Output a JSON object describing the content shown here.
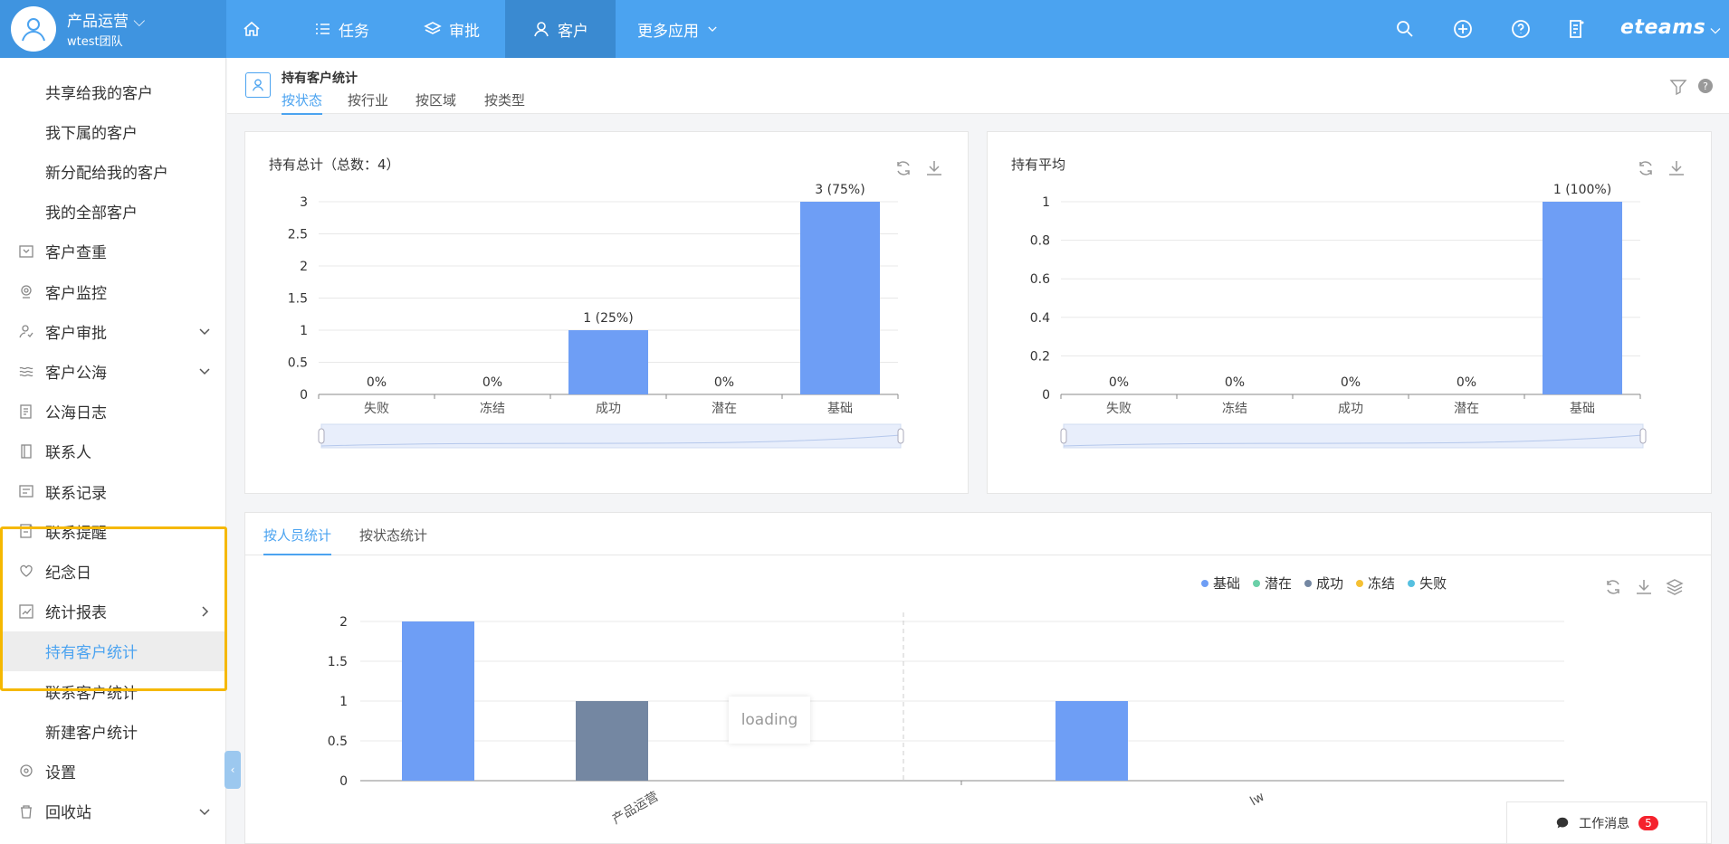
{
  "colors": {
    "topbar": "#4ba3f0",
    "bar_blue": "#6e9ef5",
    "bar_gray": "#7487a2",
    "highlight": "#f5b800",
    "accent": "#4ba3f0"
  },
  "header": {
    "team_name": "产品运营",
    "team_sub": "wtest团队",
    "nav": [
      {
        "label": "任务",
        "icon": "list-icon"
      },
      {
        "label": "审批",
        "icon": "layers-icon"
      },
      {
        "label": "客户",
        "icon": "user-icon"
      },
      {
        "label": "更多应用",
        "icon": "chevron-down-icon"
      }
    ],
    "brand": "eteams"
  },
  "sidebar": {
    "items": [
      {
        "label": "共享给我的客户",
        "icon": "",
        "sub": true
      },
      {
        "label": "我下属的客户",
        "icon": "",
        "sub": true
      },
      {
        "label": "新分配给我的客户",
        "icon": "",
        "sub": true
      },
      {
        "label": "我的全部客户",
        "icon": "",
        "sub": true
      },
      {
        "label": "客户查重",
        "icon": "dedupe-icon"
      },
      {
        "label": "客户监控",
        "icon": "camera-icon"
      },
      {
        "label": "客户审批",
        "icon": "approval-icon",
        "chevron": "down"
      },
      {
        "label": "客户公海",
        "icon": "waves-icon",
        "chevron": "down"
      },
      {
        "label": "公海日志",
        "icon": "log-icon"
      },
      {
        "label": "联系人",
        "icon": "contact-book-icon"
      },
      {
        "label": "联系记录",
        "icon": "record-icon"
      },
      {
        "label": "联系提醒",
        "icon": "reminder-icon"
      },
      {
        "label": "纪念日",
        "icon": "heart-icon"
      },
      {
        "label": "统计报表",
        "icon": "chart-icon",
        "chevron": "right"
      },
      {
        "label": "持有客户统计",
        "icon": "",
        "sub": true,
        "selected": true
      },
      {
        "label": "联系客户统计",
        "icon": "",
        "sub": true
      },
      {
        "label": "新建客户统计",
        "icon": "",
        "sub": true
      },
      {
        "label": "设置",
        "icon": "settings-icon"
      },
      {
        "label": "回收站",
        "icon": "trash-icon",
        "chevron": "down"
      }
    ]
  },
  "content": {
    "title": "持有客户统计",
    "tabs": [
      "按状态",
      "按行业",
      "按区域",
      "按类型"
    ],
    "active_tab": 0
  },
  "card1": {
    "title": "持有总计（总数：4）"
  },
  "card2": {
    "title": "持有平均"
  },
  "bottom": {
    "tabs": [
      "按人员统计",
      "按状态统计"
    ],
    "legend": [
      {
        "name": "基础",
        "color": "#6e9ef5"
      },
      {
        "name": "潜在",
        "color": "#6bd0a8"
      },
      {
        "name": "成功",
        "color": "#7487a2"
      },
      {
        "name": "冻结",
        "color": "#f5c033"
      },
      {
        "name": "失败",
        "color": "#56c0e0"
      }
    ],
    "loading": "loading"
  },
  "message": {
    "label": "工作消息",
    "count": "5"
  },
  "chart_data": [
    {
      "type": "bar",
      "title": "持有总计（总数：4）",
      "categories": [
        "失败",
        "冻结",
        "成功",
        "潜在",
        "基础"
      ],
      "values": [
        0,
        0,
        1,
        0,
        3
      ],
      "data_labels": [
        "0%",
        "0%",
        "1 (25%)",
        "0%",
        "3 (75%)"
      ],
      "yticks": [
        "0",
        "0.5",
        "1",
        "1.5",
        "2",
        "2.5",
        "3"
      ],
      "ylim": [
        0,
        3
      ]
    },
    {
      "type": "bar",
      "title": "持有平均",
      "categories": [
        "失败",
        "冻结",
        "成功",
        "潜在",
        "基础"
      ],
      "values": [
        0,
        0,
        0,
        0,
        1
      ],
      "data_labels": [
        "0%",
        "0%",
        "0%",
        "0%",
        "1 (100%)"
      ],
      "yticks": [
        "0",
        "0.2",
        "0.4",
        "0.6",
        "0.8",
        "1"
      ],
      "ylim": [
        0,
        1
      ]
    },
    {
      "type": "bar",
      "categories": [
        "产品运营",
        "lw"
      ],
      "series": [
        {
          "name": "基础",
          "values": [
            2,
            1
          ]
        },
        {
          "name": "成功",
          "values": [
            1,
            0
          ]
        }
      ],
      "yticks": [
        "0",
        "0.5",
        "1",
        "1.5",
        "2"
      ],
      "ylim": [
        0,
        2
      ]
    }
  ]
}
